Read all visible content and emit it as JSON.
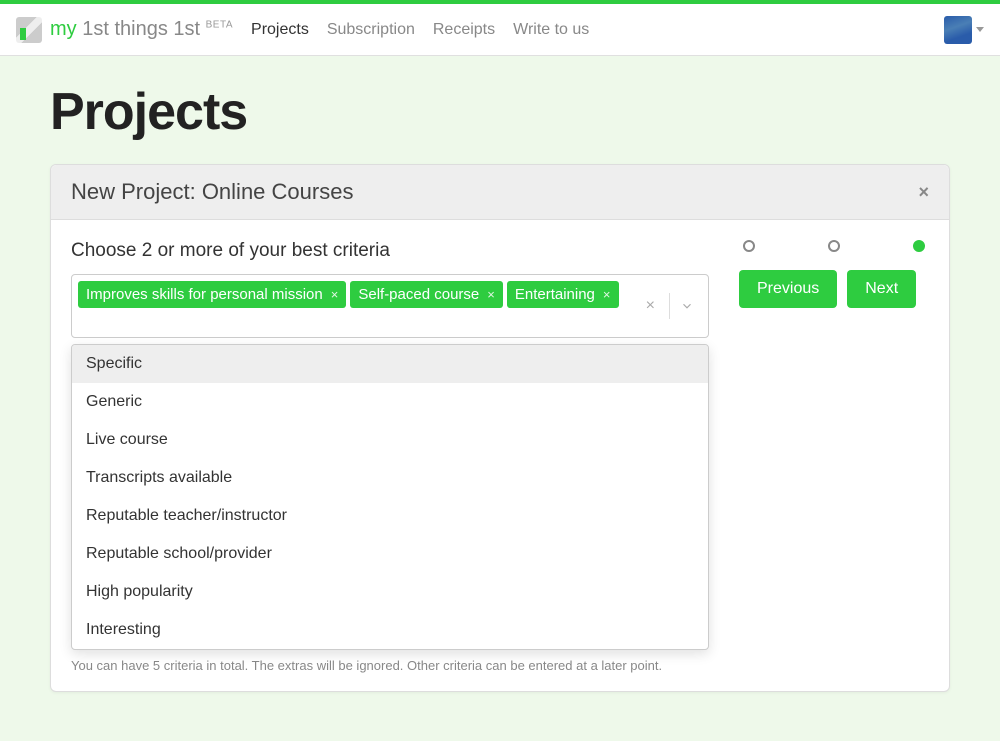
{
  "brand": {
    "my": "my",
    "rest": " 1st things 1st ",
    "beta": "BETA"
  },
  "nav": {
    "projects": "Projects",
    "subscription": "Subscription",
    "receipts": "Receipts",
    "write": "Write to us"
  },
  "page": {
    "title": "Projects"
  },
  "card": {
    "title": "New Project: Online Courses",
    "prompt": "Choose 2 or more of your best criteria",
    "chips": [
      "Improves skills for personal mission",
      "Self-paced course",
      "Entertaining"
    ],
    "options": [
      "Specific",
      "Generic",
      "Live course",
      "Transcripts available",
      "Reputable teacher/instructor",
      "Reputable school/provider",
      "High popularity",
      "Interesting"
    ],
    "hint": "You can have 5 criteria in total. The extras will be ignored. Other criteria can be entered at a later point.",
    "buttons": {
      "prev": "Previous",
      "next": "Next"
    }
  }
}
